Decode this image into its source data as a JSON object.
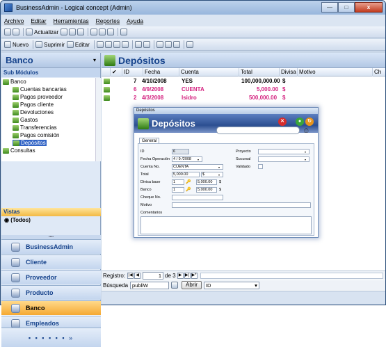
{
  "window": {
    "title": "BusinessAdmin - Logical concept (Admin)",
    "minimize": "—",
    "maximize": "□",
    "close": "x"
  },
  "menu": [
    "Archivo",
    "Editar",
    "Herramientas",
    "Reportes",
    "Ayuda"
  ],
  "toolbar1": {
    "actualizar": "Actualizar"
  },
  "toolbar2": {
    "nuevo": "Nuevo",
    "suprimir": "Suprimir",
    "editar": "Editar"
  },
  "left": {
    "header": "Banco",
    "sub_header": "Sub Módulos",
    "tree": [
      "Banco",
      "Cuentas bancarias",
      "Pagos proveedor",
      "Pagos cliente",
      "Devoluciones",
      "Gastos",
      "Transferencias",
      "Pagos comisión",
      "Depósitos",
      "Consultas"
    ],
    "vistas": "Vistas",
    "todos": "(Todos)",
    "nav": [
      "BusinessAdmin",
      "Cliente",
      "Proveedor",
      "Producto",
      "Banco",
      "Empleados"
    ]
  },
  "main": {
    "header": "Depósitos",
    "columns": [
      "ID",
      "Fecha",
      "Cuenta",
      "Total",
      "Divisa",
      "Motivo",
      "Ch"
    ],
    "rows": [
      {
        "id": "7",
        "fecha": "4/10/2008",
        "cuenta": "YES",
        "total": "100,000,000.00",
        "divisa": "$"
      },
      {
        "id": "6",
        "fecha": "4/9/2008",
        "cuenta": "CUENTA",
        "total": "5,000.00",
        "divisa": "$"
      },
      {
        "id": "2",
        "fecha": "4/3/2008",
        "cuenta": "Isidro",
        "total": "500,000.00",
        "divisa": "$"
      }
    ],
    "registro_label": "Registro:",
    "registro_value": "1",
    "registro_of": "de 3",
    "busqueda_label": "Búsqueda",
    "busqueda_value": "publiW",
    "abrir": "Abrir",
    "campo": "ID"
  },
  "dialog": {
    "titlebar": "Depósitos",
    "header": "Depósitos",
    "tab": "General",
    "labels": {
      "id": "ID",
      "fecha": "Fecha Operación",
      "cuenta": "Cuenta No.",
      "total": "Total",
      "divisa": "Divisa base",
      "banco": "Banco",
      "cheque": "Cheque No.",
      "motivo": "Motivo",
      "comentarios": "Comentarios",
      "proyecto": "Proyecto",
      "sucursal": "Sucursal",
      "validado": "Validado"
    },
    "values": {
      "id": "6",
      "fecha": "4 / 9 /2008",
      "cuenta": "CUENTA",
      "total": "5,000.00",
      "total_divisa": "$",
      "divisa_base": "1",
      "divisa_amount": "5,000.00",
      "divisa_sym": "$",
      "banco": "1",
      "banco_amount": "5,000.00",
      "banco_sym": "$"
    }
  }
}
